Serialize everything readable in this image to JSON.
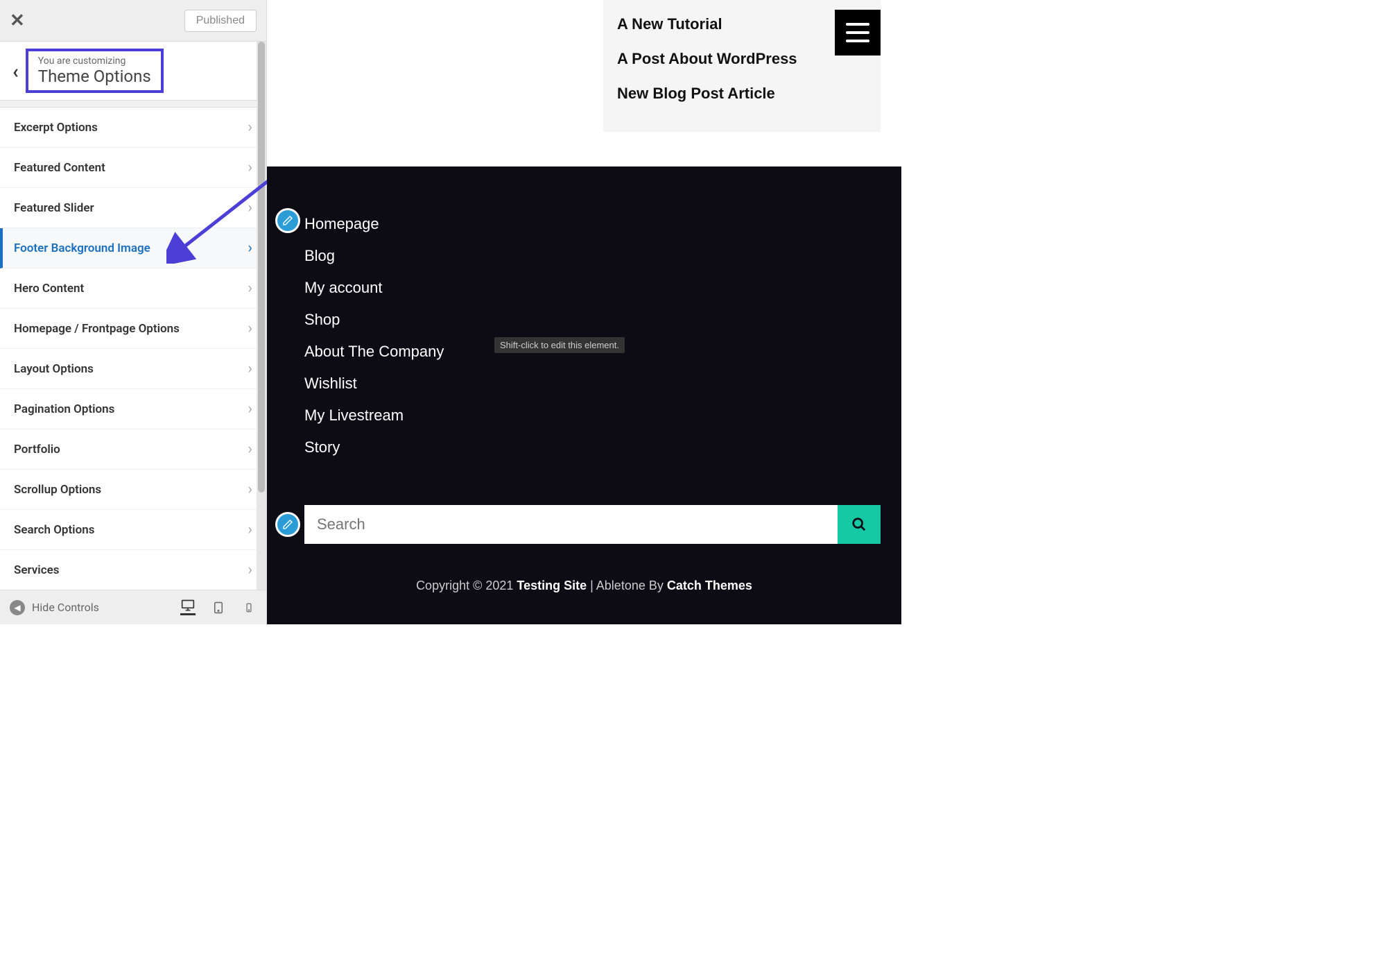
{
  "sidebar": {
    "published_label": "Published",
    "customizing_label": "You are customizing",
    "section_title": "Theme Options",
    "options": [
      {
        "label": "Excerpt Options",
        "active": false
      },
      {
        "label": "Featured Content",
        "active": false
      },
      {
        "label": "Featured Slider",
        "active": false
      },
      {
        "label": "Footer Background Image",
        "active": true
      },
      {
        "label": "Hero Content",
        "active": false
      },
      {
        "label": "Homepage / Frontpage Options",
        "active": false
      },
      {
        "label": "Layout Options",
        "active": false
      },
      {
        "label": "Pagination Options",
        "active": false
      },
      {
        "label": "Portfolio",
        "active": false
      },
      {
        "label": "Scrollup Options",
        "active": false
      },
      {
        "label": "Search Options",
        "active": false
      },
      {
        "label": "Services",
        "active": false
      }
    ],
    "hide_controls": "Hide Controls"
  },
  "preview": {
    "recent_posts": [
      "A New Tutorial",
      "A Post About WordPress",
      "New Blog Post Article"
    ],
    "footer_nav": [
      "Homepage",
      "Blog",
      "My account",
      "Shop",
      "About The Company",
      "Wishlist",
      "My Livestream",
      "Story"
    ],
    "tooltip": "Shift-click to edit this element.",
    "search_placeholder": "Search",
    "copyright_prefix": "Copyright © 2021 ",
    "site_name": "Testing Site",
    "copyright_mid": " | Abletone By ",
    "theme_author": "Catch Themes"
  }
}
